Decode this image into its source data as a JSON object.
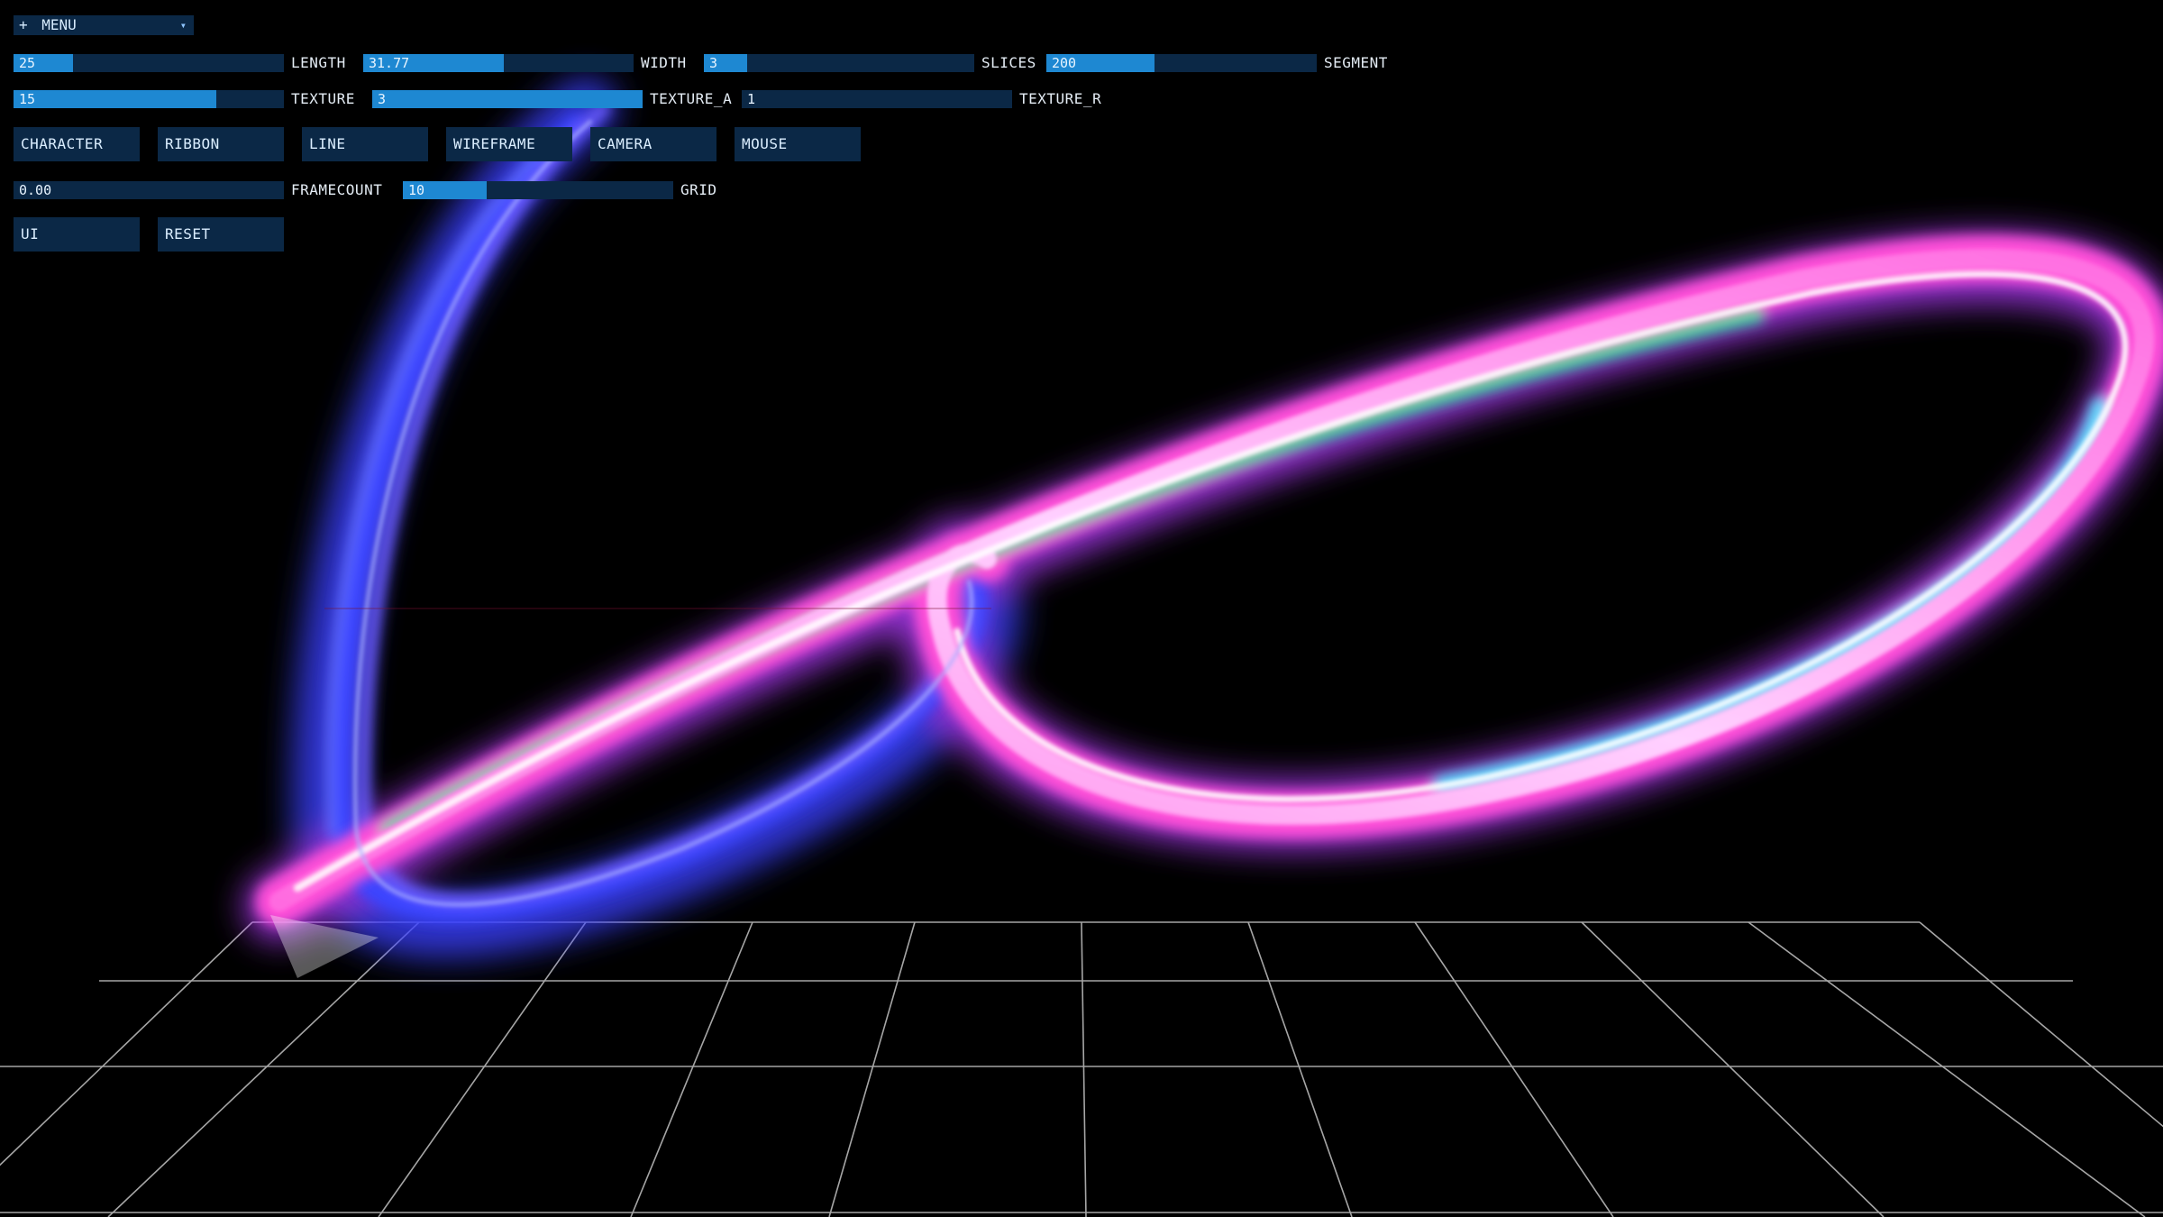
{
  "menu": {
    "label": "MENU",
    "prefix": "+",
    "arrow": "▾"
  },
  "sliders_row1": [
    {
      "value": "25",
      "label": "LENGTH",
      "fill": 0.22
    },
    {
      "value": "31.77",
      "label": "WIDTH",
      "fill": 0.52
    },
    {
      "value": "3",
      "label": "SLICES",
      "fill": 0.16
    },
    {
      "value": "200",
      "label": "SEGMENT",
      "fill": 0.4
    }
  ],
  "sliders_row2": [
    {
      "value": "15",
      "label": "TEXTURE",
      "fill": 0.75
    },
    {
      "value": "3",
      "label": "TEXTURE_A",
      "fill": 1.0
    },
    {
      "value": "1",
      "label": "TEXTURE_R",
      "fill": 0.0
    }
  ],
  "buttons_row1": [
    "CHARACTER",
    "RIBBON",
    "LINE",
    "WIREFRAME",
    "CAMERA",
    "MOUSE"
  ],
  "sliders_row3": [
    {
      "value": "0.00",
      "label": "FRAMECOUNT",
      "fill": 0.0
    },
    {
      "value": "10",
      "label": "GRID",
      "fill": 0.31
    }
  ],
  "buttons_row2": [
    "UI",
    "RESET"
  ],
  "colors": {
    "panel": "#0b2846",
    "slider_fill": "#1e88d2",
    "ribbon_pink": "#ff4fd8",
    "ribbon_violet": "#7a3cff",
    "ribbon_blue": "#3a4dff",
    "ribbon_cyan": "#5fe0ff",
    "ribbon_green": "#2fd79a",
    "grid": "#bfbfbf"
  }
}
